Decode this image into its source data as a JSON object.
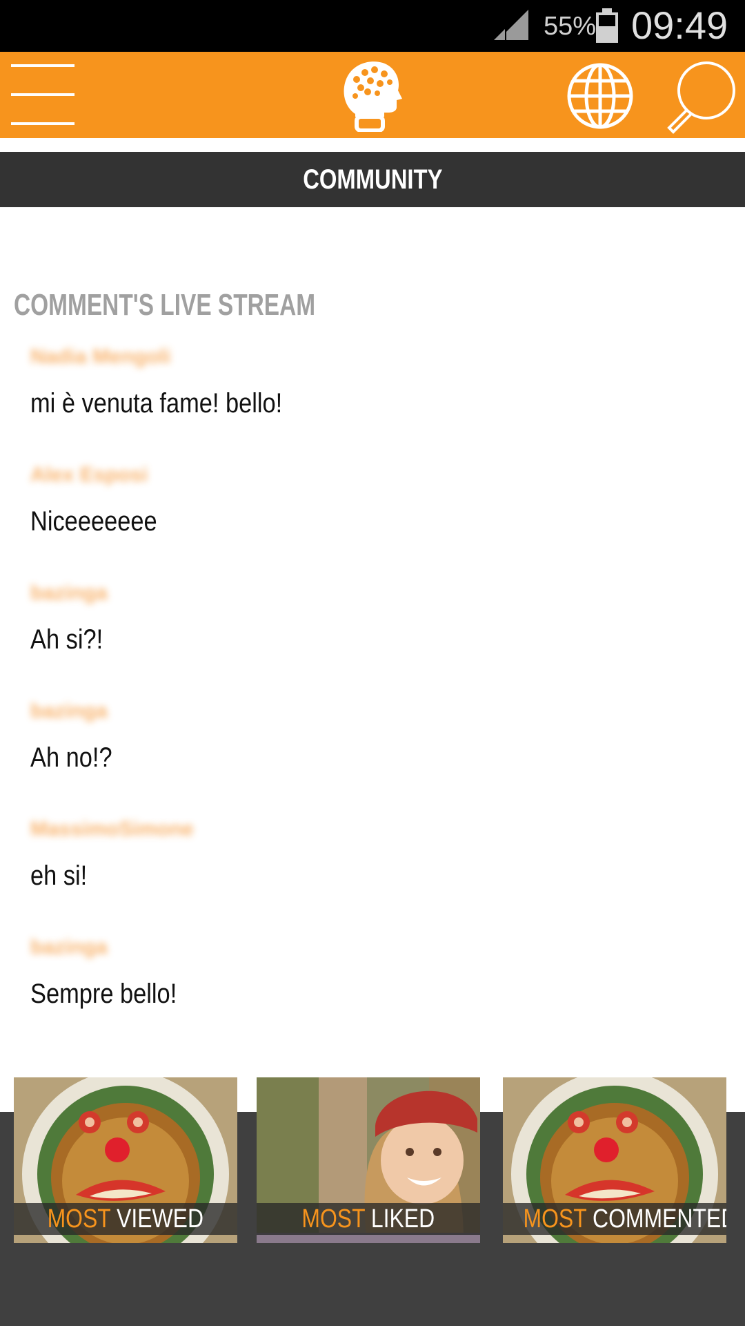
{
  "status_bar": {
    "battery_percent": "55%",
    "time": "09:49"
  },
  "header": {
    "menu_icon": "hamburger-menu-icon",
    "logo_icon": "brain-head-logo-icon",
    "globe_icon": "globe-icon",
    "search_icon": "search-icon",
    "accent_color": "#f7941d"
  },
  "section": {
    "title": "COMMUNITY"
  },
  "live_stream": {
    "title": "COMMENT'S LIVE STREAM",
    "comments": [
      {
        "user": "Nadia Mengoli",
        "text": "mi è venuta fame! bello!"
      },
      {
        "user": "Alex Esposi",
        "text": "Niceeeeeee"
      },
      {
        "user": "bazinga",
        "text": "Ah si?!"
      },
      {
        "user": "bazinga",
        "text": "Ah no!?"
      },
      {
        "user": "MassimoSimone",
        "text": "eh si!"
      },
      {
        "user": "bazinga",
        "text": "Sempre bello!"
      }
    ]
  },
  "tiles": [
    {
      "word1": "MOST",
      "word2": "VIEWED",
      "image": "pancake-face-plate"
    },
    {
      "word1": "MOST",
      "word2": "LIKED",
      "image": "smiling-girl-red-hat"
    },
    {
      "word1": "MOST",
      "word2": "COMMENTED",
      "image": "pancake-face-plate"
    }
  ]
}
